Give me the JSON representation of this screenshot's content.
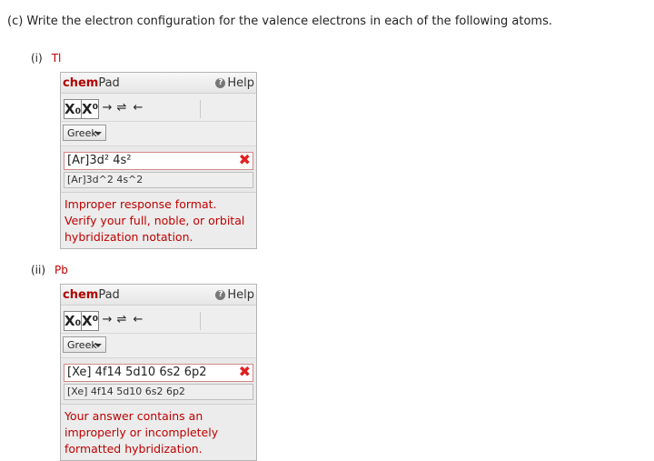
{
  "question": "(c)   Write the electron configuration for the valence electrons in each of the following atoms.",
  "chempad": {
    "brand_bold": "chem",
    "brand_rest": "Pad",
    "help_label": "Help",
    "help_icon": "?",
    "sub_label": "X₀",
    "sup_label": "X⁰",
    "arrow_right": "→",
    "arrow_equilibrium": "⇌",
    "arrow_left": "←",
    "greek_label": "Greek"
  },
  "parts": [
    {
      "label": "(i)",
      "element": "Tl",
      "answer": "[Ar]3d² 4s²",
      "answer_raw": "[Ar]3d^2 4s^2",
      "message": [
        "Improper response format.",
        "Verify your full, noble, or orbital",
        "hybridization notation."
      ]
    },
    {
      "label": "(ii)",
      "element": "Pb",
      "answer": "[Xe] 4f14 5d10 6s2 6p2",
      "answer_raw": "[Xe] 4f14 5d10 6s2 6p2",
      "message": [
        "Your answer contains an",
        "improperly or incompletely",
        "formatted hybridization."
      ]
    }
  ],
  "error_mark": "✖",
  "colors": {
    "error": "#c00000",
    "brand": "#b00000"
  }
}
